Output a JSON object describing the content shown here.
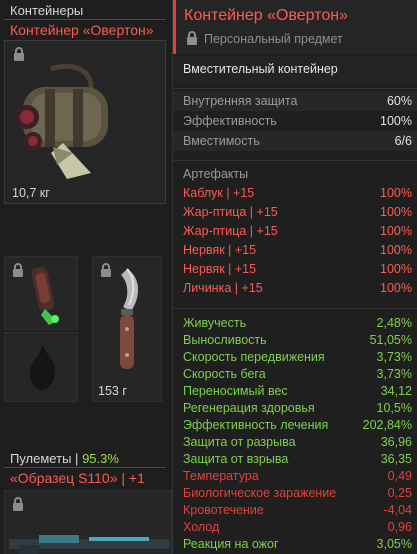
{
  "inventory": {
    "section_title": "Контейнеры",
    "container_name": "Контейнер «Овертон»",
    "container_weight": "10,7 кг",
    "knife_weight": "153 г",
    "weapons_section_label": "Пулеметы",
    "weapons_separator": "|",
    "weapons_percent": "95.3%",
    "weapon_name": "«Образец S110» | +1"
  },
  "tooltip": {
    "title": "Контейнер «Овертон»",
    "subtitle": "Персональный предмет",
    "class": "Вместительный контейнер",
    "base_stats": [
      {
        "label": "Внутренняя защита",
        "value": "60%"
      },
      {
        "label": "Эффективность",
        "value": "100%"
      },
      {
        "label": "Вместимость",
        "value": "6/6"
      }
    ],
    "artifacts_label": "Артефакты",
    "artifacts": [
      {
        "label": "Каблук | +15",
        "value": "100%"
      },
      {
        "label": "Жар-птица | +15",
        "value": "100%"
      },
      {
        "label": "Жар-птица | +15",
        "value": "100%"
      },
      {
        "label": "Нервяк | +15",
        "value": "100%"
      },
      {
        "label": "Нервяк | +15",
        "value": "100%"
      },
      {
        "label": "Личинка | +15",
        "value": "100%"
      }
    ],
    "effects": [
      {
        "label": "Живучесть",
        "value": "2,48%",
        "negative": false
      },
      {
        "label": "Выносливость",
        "value": "51,05%",
        "negative": false
      },
      {
        "label": "Скорость передвижения",
        "value": "3,73%",
        "negative": false
      },
      {
        "label": "Скорость бега",
        "value": "3,73%",
        "negative": false
      },
      {
        "label": "Переносимый вес",
        "value": "34,12",
        "negative": false
      },
      {
        "label": "Регенерация здоровья",
        "value": "10,5%",
        "negative": false
      },
      {
        "label": "Эффективность лечения",
        "value": "202,84%",
        "negative": false
      },
      {
        "label": "Защита от разрыва",
        "value": "36,96",
        "negative": false
      },
      {
        "label": "Защита от взрыва",
        "value": "36,35",
        "negative": false
      },
      {
        "label": "Температура",
        "value": "0,49",
        "negative": true
      },
      {
        "label": "Биологическое заражение",
        "value": "0,25",
        "negative": true
      },
      {
        "label": "Кровотечение",
        "value": "-4,04",
        "negative": true
      },
      {
        "label": "Холод",
        "value": "0,96",
        "negative": true
      },
      {
        "label": "Реакция на ожог",
        "value": "3,05%",
        "negative": false
      }
    ]
  },
  "colors": {
    "accent_red": "#ff5a52",
    "positive_green": "#7fd14a",
    "negative_red": "#e2413b"
  }
}
